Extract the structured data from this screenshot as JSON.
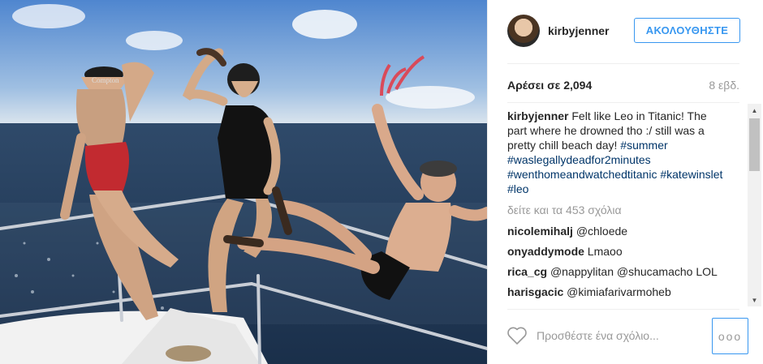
{
  "post": {
    "username": "kirbyjenner",
    "follow_label": "ΑΚΟΛΟΥΘΗΣΤΕ",
    "likes": "Αρέσει σε 2,094",
    "time": "8 εβδ.",
    "caption_user": "kirbyjenner",
    "caption_text": "Felt like Leo in Titanic! The part where he drowned tho :/ still was a pretty chill beach day!",
    "hashtags": [
      "#summer",
      "#waslegallydeadfor2minutes",
      "#wenthomeandwatchedtitanic",
      "#katewinslet",
      "#leo"
    ],
    "hat_text": "Compton",
    "view_more": "δείτε και τα 453 σχόλια",
    "comment_placeholder": "Προσθέστε ένα σχόλιο...",
    "more_label": "ooo"
  },
  "comments": [
    {
      "user": "nicolemihalj",
      "text": "@chloede"
    },
    {
      "user": "onyaddymode",
      "text": "Lmaoo"
    },
    {
      "user": "rica_cg",
      "text": "@nappylitan @shucamacho LOL"
    },
    {
      "user": "harisgacic",
      "text": "@kimiafarivarmoheb"
    }
  ],
  "icons": {
    "heart": "heart-outline-icon",
    "scroll_up": "scroll-up-arrow",
    "scroll_down": "scroll-down-arrow"
  }
}
